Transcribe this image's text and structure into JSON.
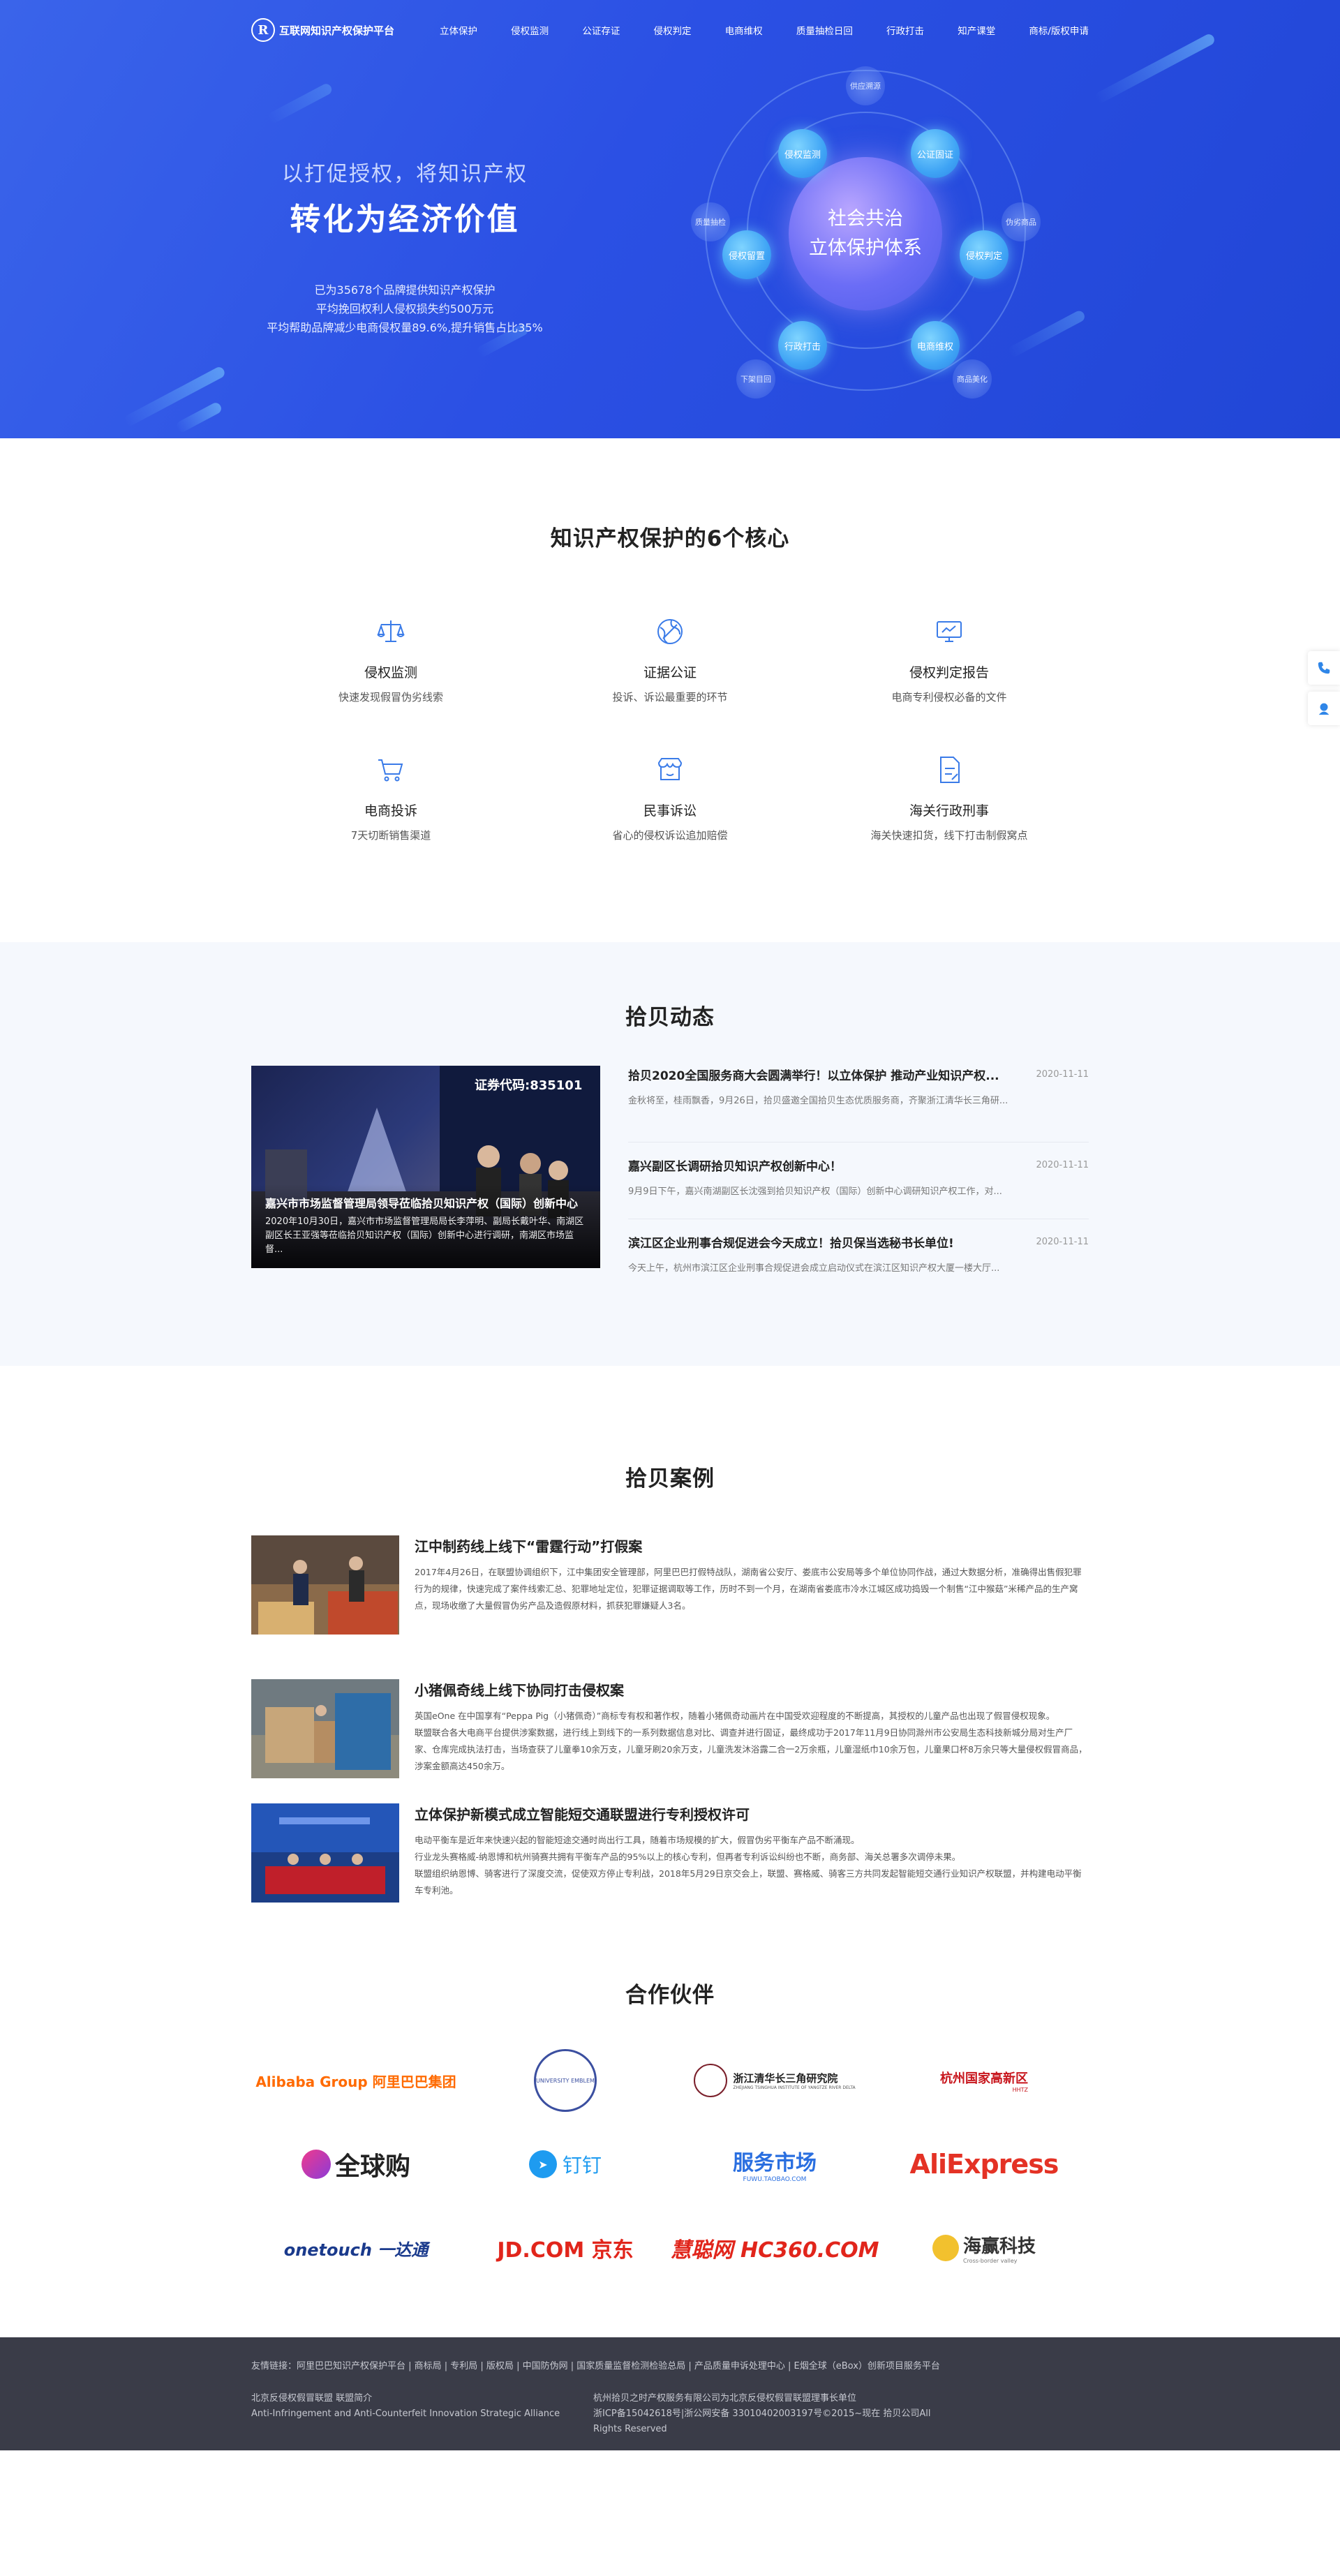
{
  "header": {
    "logo_mark": "R",
    "logo_text": "互联网知识产权保护平台",
    "menu": [
      "立体保护",
      "侵权监测",
      "公证存证",
      "侵权判定",
      "电商维权",
      "质量抽检日回",
      "行政打击",
      "知产课堂",
      "商标/版权申请"
    ]
  },
  "hero": {
    "subtitle": "以打促授权，将知识产权",
    "title": "转化为经济价值",
    "stats": [
      "已为35678个品牌提供知识产权保护",
      "平均挽回权利人侵权损失约500万元",
      "平均帮助品牌减少电商侵权量89.6%,提升销售占比35%"
    ],
    "core_line1": "社会共治",
    "core_line2": "立体保护体系",
    "nodes": [
      "侵权监测",
      "公证固证",
      "侵权判定",
      "电商维权",
      "行政打击",
      "侵权留置"
    ],
    "small_nodes": [
      "供应溯源",
      "伪劣商品",
      "商品美化",
      "下架目回",
      "质量抽检"
    ]
  },
  "cores": {
    "title": "知识产权保护的6个核心",
    "items": [
      {
        "title": "侵权监测",
        "desc": "快速发现假冒伪劣线索",
        "icon": "scale-icon"
      },
      {
        "title": "证据公证",
        "desc": "投诉、诉讼最重要的环节",
        "icon": "globe-icon"
      },
      {
        "title": "侵权判定报告",
        "desc": "电商专利侵权必备的文件",
        "icon": "monitor-icon"
      },
      {
        "title": "电商投诉",
        "desc": "7天切断销售渠道",
        "icon": "cart-icon"
      },
      {
        "title": "民事诉讼",
        "desc": "省心的侵权诉讼追加赔偿",
        "icon": "shop-icon"
      },
      {
        "title": "海关行政刑事",
        "desc": "海关快速扣货，线下打击制假窝点",
        "icon": "document-icon"
      }
    ]
  },
  "news": {
    "title": "拾贝动态",
    "featured": {
      "title": "嘉兴市市场监督管理局领导莅临拾贝知识产权（国际）创新中心",
      "desc": "2020年10月30日，嘉兴市市场监督管理局局长李萍明、副局长戴叶华、南湖区副区长王亚强等莅临拾贝知识产权（国际）创新中心进行调研，南湖区市场监督...",
      "screen_text": "证券代码:835101"
    },
    "items": [
      {
        "title": "拾贝2020全国服务商大会圆满举行！以立体保护 推动产业知识产权...",
        "date": "2020-11-11",
        "desc": "金秋将至，桂雨飘香，9月26日，拾贝盛邀全国拾贝生态优质服务商，齐聚浙江清华长三角研..."
      },
      {
        "title": "嘉兴副区长调研拾贝知识产权创新中心！",
        "date": "2020-11-11",
        "desc": "9月9日下午，嘉兴南湖副区长沈强到拾贝知识产权（国际）创新中心调研知识产权工作，对..."
      },
      {
        "title": "滨江区企业刑事合规促进会今天成立！拾贝保当选秘书长单位!",
        "date": "2020-11-11",
        "desc": "今天上午，杭州市滨江区企业刑事合规促进会成立启动仪式在滨江区知识产权大厦一楼大厅..."
      }
    ]
  },
  "cases": {
    "title": "拾贝案例",
    "items": [
      {
        "title": "江中制药线上线下“雷霆行动”打假案",
        "paras": [
          "2017年4月26日，在联盟协调组织下，江中集团安全管理部，阿里巴巴打假特战队，湖南省公安厅、娄底市公安局等多个单位协同作战，通过大数据分析，准确得出售假犯罪行为的规律，快速完成了案件线索汇总、犯罪地址定位，犯罪证据调取等工作，历时不到一个月，在湖南省娄底市冷水江城区成功捣毁一个制售“江中猴菇”米稀产品的生产窝点，现场收缴了大量假冒伪劣产品及造假原材料，抓获犯罪嫌疑人3名。"
        ]
      },
      {
        "title": "小猪佩奇线上线下协同打击侵权案",
        "paras": [
          "英国eOne 在中国享有“Peppa Pig（小猪佩奇）”商标专有权和著作权，随着小猪佩奇动画片在中国受欢迎程度的不断提高，其授权的儿童产品也出现了假冒侵权现象。",
          "联盟联合各大电商平台提供涉案数据，进行线上到线下的一系列数据信息对比、调查并进行固证，最终成功于2017年11月9日协同滁州市公安局生态科技新城分局对生产厂家、仓库完成执法打击，当场查获了儿童拳10余万支，儿童牙刷20余万支，儿童洗发沐浴露二合一2万余瓶，儿童湿纸巾10余万包，儿童果口杯8万余只等大量侵权假冒商品，涉案金额高达450余万。"
        ]
      },
      {
        "title": "立体保护新模式成立智能短交通联盟进行专利授权许可",
        "paras": [
          "电动平衡车是近年来快速兴起的智能短途交通时尚出行工具，随着市场规模的扩大，假冒伪劣平衡车产品不断涌现。",
          "行业龙头赛格威-纳恩博和杭州骑赛共拥有平衡车产品的95%以上的核心专利，但再者专利诉讼纠纷也不断，商务部、海关总署多次调停未果。",
          "联盟组织纳恩博、骑客进行了深度交流，促使双方停止专利战，2018年5月29日京交会上，联盟、赛格威、骑客三方共同发起智能短交通行业知识产权联盟，并构建电动平衡车专利池。"
        ]
      }
    ]
  },
  "partners": {
    "title": "合作伙伴",
    "logos": [
      "Alibaba Group 阿里巴巴集团",
      "UNIVERSITY EMBLEM",
      "浙江清华长三角研究院",
      "杭州国家高新区",
      "全球购",
      "钉钉",
      "服务市场",
      "AliExpress",
      "onetouch 一达通",
      "JD.COM 京东",
      "慧聪网 HC360.COM",
      "海赢科技"
    ]
  },
  "partner_sub": {
    "tsinghua_en": "ZHEJIANG TSINGHUA INSTITUTE OF YANGTZE RIVER DELTA",
    "fuwu_en": "FUWU.TAOBAO.COM",
    "haiying_en": "Cross-border valley",
    "hz_en": "HHTZ"
  },
  "footer": {
    "links": "友情链接：阿里巴巴知识产权保护平台 | 商标局 | 专利局 | 版权局 | 中国防伪网 | 国家质量监督检测检验总局 | 产品质量申诉处理中心 | E烟全球（eBox）创新项目服务平台",
    "org_cn": "北京反侵权假冒联盟 联盟简介",
    "org_en": "Anti-Infringement and Anti-Counterfeit Innovation Strategic Alliance",
    "company": "杭州拾贝之时产权服务有限公司为北京反侵权假冒联盟理事长单位",
    "icp": "浙ICP备15042618号|浙公网安备 33010402003197号©2015~现在 拾贝公司All Rights Reserved"
  },
  "colors": {
    "primary": "#2b50e4",
    "accent": "#3a7be8",
    "footer_bg": "#3a3c48"
  }
}
